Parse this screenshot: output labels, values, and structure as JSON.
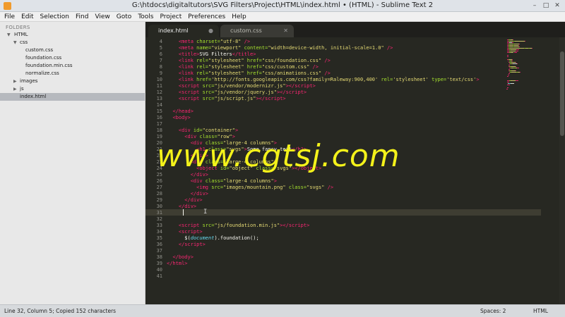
{
  "window": {
    "title": "G:\\htdocs\\digitaltutors\\SVG Filters\\Project\\HTML\\index.html • (HTML) - Sublime Text 2",
    "controls": {
      "minimize": "–",
      "maximize": "□",
      "close": "✕"
    }
  },
  "menu": [
    "File",
    "Edit",
    "Selection",
    "Find",
    "View",
    "Goto",
    "Tools",
    "Project",
    "Preferences",
    "Help"
  ],
  "sidebar": {
    "header": "FOLDERS",
    "tree": [
      {
        "label": "HTML",
        "arrow": "▼"
      },
      {
        "label": "css",
        "arrow": "▼"
      },
      {
        "label": "custom.css",
        "arrow": ""
      },
      {
        "label": "foundation.css",
        "arrow": ""
      },
      {
        "label": "foundation.min.css",
        "arrow": ""
      },
      {
        "label": "normalize.css",
        "arrow": ""
      },
      {
        "label": "images",
        "arrow": "▶"
      },
      {
        "label": "js",
        "arrow": "▶"
      },
      {
        "label": "index.html",
        "arrow": ""
      }
    ]
  },
  "tabs": [
    {
      "label": "index.html",
      "indicator": "●",
      "active": true
    },
    {
      "label": "custom.css",
      "indicator": "✕",
      "active": false
    }
  ],
  "editor": {
    "line_numbers": [
      "4",
      "5",
      "6",
      "7",
      "8",
      "9",
      "10",
      "11",
      "12",
      "13",
      "14",
      "15",
      "16",
      "17",
      "18",
      "19",
      "20",
      "21",
      "22",
      "23",
      "24",
      "25",
      "26",
      "27",
      "28",
      "29",
      "30",
      "31",
      "32",
      "33",
      "34",
      "35",
      "36",
      "37",
      "38",
      "39",
      "40",
      "41"
    ],
    "lines": [
      [
        [
          "    ",
          "p"
        ],
        [
          "<meta",
          "t"
        ],
        [
          " charset=",
          "a"
        ],
        [
          "\"utf-8\"",
          "s"
        ],
        [
          " />",
          "t"
        ]
      ],
      [
        [
          "    ",
          "p"
        ],
        [
          "<meta",
          "t"
        ],
        [
          " name=",
          "a"
        ],
        [
          "\"viewport\"",
          "s"
        ],
        [
          " content=",
          "a"
        ],
        [
          "\"width=device-width, initial-scale=1.0\"",
          "s"
        ],
        [
          " />",
          "t"
        ]
      ],
      [
        [
          "    ",
          "p"
        ],
        [
          "<title>",
          "t"
        ],
        [
          "SVG Filters",
          "p"
        ],
        [
          "</title>",
          "t"
        ]
      ],
      [
        [
          "    ",
          "p"
        ],
        [
          "<link",
          "t"
        ],
        [
          " rel=",
          "a"
        ],
        [
          "\"stylesheet\"",
          "s"
        ],
        [
          " href=",
          "a"
        ],
        [
          "\"css/foundation.css\"",
          "s"
        ],
        [
          " />",
          "t"
        ]
      ],
      [
        [
          "    ",
          "p"
        ],
        [
          "<link",
          "t"
        ],
        [
          " rel=",
          "a"
        ],
        [
          "\"stylesheet\"",
          "s"
        ],
        [
          " href=",
          "a"
        ],
        [
          "\"css/custom.css\"",
          "s"
        ],
        [
          " />",
          "t"
        ]
      ],
      [
        [
          "    ",
          "p"
        ],
        [
          "<link",
          "t"
        ],
        [
          " rel=",
          "a"
        ],
        [
          "\"stylesheet\"",
          "s"
        ],
        [
          " href=",
          "a"
        ],
        [
          "\"css/animations.css\"",
          "s"
        ],
        [
          " />",
          "t"
        ]
      ],
      [
        [
          "    ",
          "p"
        ],
        [
          "<link",
          "t"
        ],
        [
          " href=",
          "a"
        ],
        [
          "'http://fonts.googleapis.com/css?family=Raleway:900,400'",
          "s"
        ],
        [
          " rel=",
          "a"
        ],
        [
          "'stylesheet'",
          "s"
        ],
        [
          " type=",
          "a"
        ],
        [
          "'text/css'",
          "s"
        ],
        [
          ">",
          "t"
        ]
      ],
      [
        [
          "    ",
          "p"
        ],
        [
          "<script",
          "t"
        ],
        [
          " src=",
          "a"
        ],
        [
          "\"js/vendor/modernizr.js\"",
          "s"
        ],
        [
          "></",
          "t"
        ],
        [
          "script",
          "t"
        ],
        [
          ">",
          "t"
        ]
      ],
      [
        [
          "    ",
          "p"
        ],
        [
          "<script",
          "t"
        ],
        [
          " src=",
          "a"
        ],
        [
          "\"js/vendor/jquery.js\"",
          "s"
        ],
        [
          "></",
          "t"
        ],
        [
          "script",
          "t"
        ],
        [
          ">",
          "t"
        ]
      ],
      [
        [
          "    ",
          "p"
        ],
        [
          "<script",
          "t"
        ],
        [
          " src=",
          "a"
        ],
        [
          "\"js/script.js\"",
          "s"
        ],
        [
          "></",
          "t"
        ],
        [
          "script",
          "t"
        ],
        [
          ">",
          "t"
        ]
      ],
      [
        [
          "",
          "p"
        ]
      ],
      [
        [
          "  ",
          "p"
        ],
        [
          "</head>",
          "t"
        ]
      ],
      [
        [
          "  ",
          "p"
        ],
        [
          "<body>",
          "t"
        ]
      ],
      [
        [
          "",
          "p"
        ]
      ],
      [
        [
          "    ",
          "p"
        ],
        [
          "<div",
          "t"
        ],
        [
          " id=",
          "a"
        ],
        [
          "\"container\"",
          "s"
        ],
        [
          ">",
          "t"
        ]
      ],
      [
        [
          "      ",
          "p"
        ],
        [
          "<div",
          "t"
        ],
        [
          " class=",
          "a"
        ],
        [
          "\"row\"",
          "s"
        ],
        [
          ">",
          "t"
        ]
      ],
      [
        [
          "        ",
          "p"
        ],
        [
          "<div",
          "t"
        ],
        [
          " class=",
          "a"
        ],
        [
          "\"large-4 columns\"",
          "s"
        ],
        [
          ">",
          "t"
        ]
      ],
      [
        [
          "          ",
          "p"
        ],
        [
          "<h1",
          "t"
        ],
        [
          " class=",
          "a"
        ],
        [
          "\"svgs\"",
          "s"
        ],
        [
          ">",
          "t"
        ],
        [
          "Some fancy text",
          "p"
        ],
        [
          "</h1>",
          "t"
        ]
      ],
      [
        [
          "        ",
          "p"
        ],
        [
          "</div>",
          "t"
        ]
      ],
      [
        [
          "        ",
          "p"
        ],
        [
          "<div",
          "t"
        ],
        [
          " class=",
          "a"
        ],
        [
          "\"large-4 columns\"",
          "s"
        ],
        [
          ">",
          "t"
        ]
      ],
      [
        [
          "          ",
          "p"
        ],
        [
          "<object",
          "t"
        ],
        [
          " id=",
          "a"
        ],
        [
          "\"object\"",
          "s"
        ],
        [
          " class=",
          "a"
        ],
        [
          "\"svgs\"",
          "s"
        ],
        [
          "></object>",
          "t"
        ]
      ],
      [
        [
          "        ",
          "p"
        ],
        [
          "</div>",
          "t"
        ]
      ],
      [
        [
          "        ",
          "p"
        ],
        [
          "<div",
          "t"
        ],
        [
          " class=",
          "a"
        ],
        [
          "\"large-4 columns\"",
          "s"
        ],
        [
          ">",
          "t"
        ]
      ],
      [
        [
          "          ",
          "p"
        ],
        [
          "<img",
          "t"
        ],
        [
          " src=",
          "a"
        ],
        [
          "\"images/mountain.png\"",
          "s"
        ],
        [
          " class=",
          "a"
        ],
        [
          "\"svgs\"",
          "s"
        ],
        [
          " />",
          "t"
        ]
      ],
      [
        [
          "        ",
          "p"
        ],
        [
          "</div>",
          "t"
        ]
      ],
      [
        [
          "      ",
          "p"
        ],
        [
          "</div>",
          "t"
        ]
      ],
      [
        [
          "    ",
          "p"
        ],
        [
          "</div>",
          "t"
        ]
      ],
      [
        [
          "",
          "p"
        ]
      ],
      [
        [
          "",
          "p"
        ]
      ],
      [
        [
          "    ",
          "p"
        ],
        [
          "<script",
          "t"
        ],
        [
          " src=",
          "a"
        ],
        [
          "\"js/foundation.min.js\"",
          "s"
        ],
        [
          "></",
          "t"
        ],
        [
          "script",
          "t"
        ],
        [
          ">",
          "t"
        ]
      ],
      [
        [
          "    ",
          "p"
        ],
        [
          "<script>",
          "t"
        ]
      ],
      [
        [
          "      ",
          "p"
        ],
        [
          "$(",
          "p"
        ],
        [
          "document",
          "f"
        ],
        [
          ").foundation();",
          "p"
        ]
      ],
      [
        [
          "    ",
          "p"
        ],
        [
          "</",
          "t"
        ],
        [
          "script",
          "t"
        ],
        [
          ">",
          "t"
        ]
      ],
      [
        [
          "",
          "p"
        ]
      ],
      [
        [
          "  ",
          "p"
        ],
        [
          "</body>",
          "t"
        ]
      ],
      [
        [
          "",
          "p"
        ],
        [
          "</html>",
          "t"
        ]
      ],
      [
        [
          "",
          "p"
        ]
      ],
      [
        [
          "",
          "p"
        ]
      ]
    ]
  },
  "watermark": "www.cgtsj.com",
  "statusbar": {
    "position": "Line 32, Column 5; Copied 152 characters",
    "spaces": "Spaces: 2",
    "syntax": "HTML"
  },
  "colors": {
    "tag": "#f92672",
    "attr": "#a6e22e",
    "string": "#e6db74",
    "function": "#66d9ef",
    "text": "#f8f8f2",
    "watermark": "#f4f21a"
  }
}
